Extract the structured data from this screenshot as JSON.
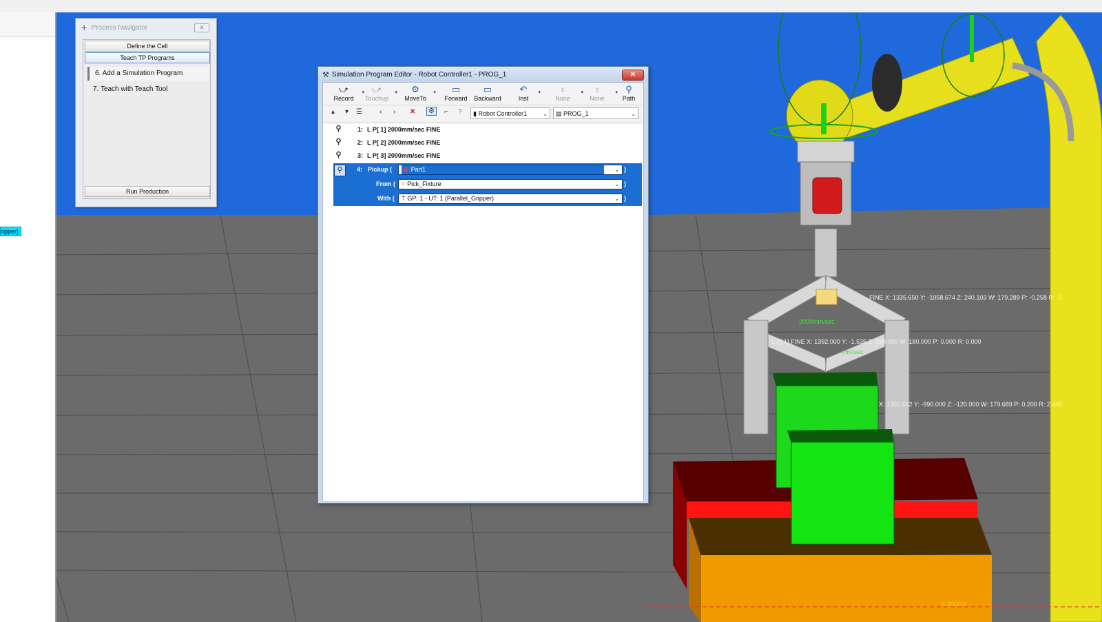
{
  "left_panel": {
    "badge": "ripper)"
  },
  "navigator": {
    "title": "Process Navigator",
    "close": "✕",
    "buttons": [
      "Define the Cell",
      "Teach TP Programs",
      "Run Production"
    ],
    "steps": [
      "6.  Add a Simulation Program",
      "7.  Teach with Teach Tool"
    ]
  },
  "editor": {
    "title": "Simulation Program Editor - Robot Controller1 - PROG_1",
    "close": "✕",
    "toolbar": {
      "record": "Record",
      "touchup": "Touchup",
      "moveto": "MoveTo",
      "forward": "Forward",
      "backward": "Backward",
      "inst": "Inst",
      "none1": "None",
      "none2": "None",
      "path": "Path"
    },
    "controller_select": "Robot Controller1",
    "program_select": "PROG_1",
    "lines": [
      {
        "num": "1:",
        "text": "L P[ 1] 2000mm/sec FINE"
      },
      {
        "num": "2:",
        "text": "L P[ 2] 2000mm/sec FINE"
      },
      {
        "num": "3:",
        "text": "L P[ 3] 2000mm/sec FINE"
      }
    ],
    "pickup": {
      "num": "4:",
      "pickup_label": "Pickup (",
      "pickup_value": "Part1",
      "from_label": "From (",
      "from_value": "Pick_Fixture",
      "with_label": "With (",
      "with_value": "GP: 1 - UT: 1  (Parallel_Gripper)",
      "close_paren": ")"
    }
  },
  "scene": {
    "label_fine1": "FINE X: 1335.650 Y: -1058.674 Z: 240.103 W: 179.289 P: -0.258 R: -0",
    "label_p1": "L P[ 1]  FINE X: 1392.000 Y: -1.535 Z: 230.000 W: 180.000 P: 0.000 R: 0.000",
    "label_mm": "mm/sec",
    "label_xyz": "X: 1350.612 Y: -990.000 Z: -120.000 W: 179.689 P: 0.209 R: 2.440",
    "label_axis": "X-2000.0",
    "label_speed": "2000mm/sec"
  }
}
